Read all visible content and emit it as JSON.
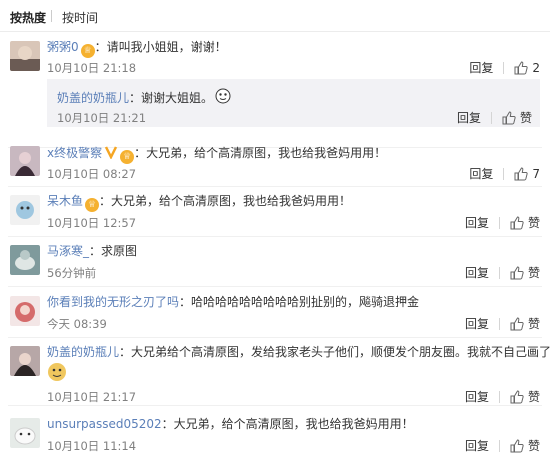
{
  "sort": {
    "hot": "按热度",
    "time": "按时间"
  },
  "comments": [
    {
      "user": "粥粥0",
      "badge": "vip",
      "text": "：请叫我小姐姐，谢谢！",
      "time": "10月10日 21:18",
      "reply": "回复",
      "like": "2"
    },
    {
      "user": "x终极警察",
      "badge": "v-vip",
      "text": "：大兄弟，给个高清原图，我也给我爸妈用用！",
      "time": "10月10日 08:27",
      "reply": "回复",
      "like": "7"
    },
    {
      "user": "呆木鱼",
      "badge": "vip",
      "text": "：大兄弟，给个高清原图，我也给我爸妈用用！",
      "time": "10月10日 12:57",
      "reply": "回复",
      "like": "赞"
    },
    {
      "user": "马涿寒_",
      "text": "：求原图",
      "time": "56分钟前",
      "reply": "回复",
      "like": "赞"
    },
    {
      "user": "你看到我的无形之刃了吗",
      "text": "：哈哈哈哈哈哈哈哈哈别扯别的，飚骑退押金",
      "time": "今天 08:39",
      "reply": "回复",
      "like": "赞"
    },
    {
      "user": "奶盖的奶瓶儿",
      "text": "：大兄弟给个高清原图，发给我家老头子他们，顺便发个朋友圈。我就不自己画了。",
      "time": "10月10日 21:17",
      "reply": "回复",
      "like": "赞"
    },
    {
      "user": "unsurpassed05202",
      "text": "：大兄弟，给个高清原图，我也给我爸妈用用！",
      "time": "10月10日 11:14",
      "reply": "回复",
      "like": "赞"
    }
  ],
  "subreply": {
    "user": "奶盖的奶瓶儿",
    "text": "：谢谢大姐姐。",
    "time": "10月10日 21:21",
    "reply": "回复",
    "like": "赞"
  },
  "colors": {
    "name_orange": "#eb7350",
    "name_blue": "#5b7fb8",
    "meta_gray": "#808080",
    "reply_bg": "#f2f2f5"
  }
}
